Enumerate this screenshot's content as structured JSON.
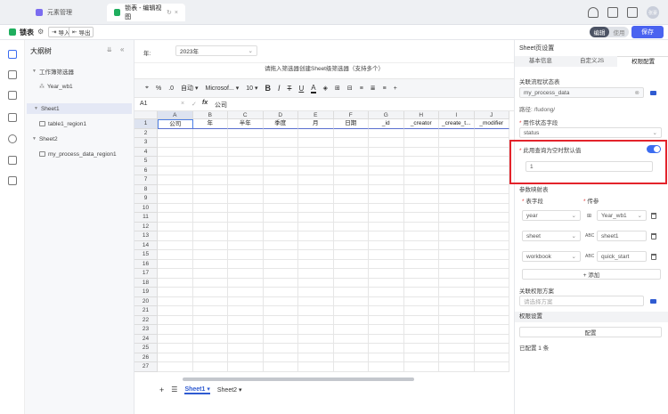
{
  "tabs": {
    "elements": "元素管理",
    "sheet_edit": "锁表 - 编辑视图"
  },
  "avatar_text": "张豪",
  "toolbar": {
    "title": "锁表",
    "import": "导入",
    "export": "导出",
    "mode_edit": "编辑",
    "mode_use": "使用",
    "save": "保存"
  },
  "outline": {
    "title": "大纲树",
    "filter_group": "工作簿筛选器",
    "filter_item": "Year_wb1",
    "sheet1": "Sheet1",
    "sheet1_region": "table1_region1",
    "sheet2": "Sheet2",
    "sheet2_region": "my_process_data_region1"
  },
  "filter": {
    "label": "年:",
    "value": "2023年",
    "hint": "请拖入筛选器创建Sheet级筛选器（支持多个）"
  },
  "format": {
    "font": "Microsof...",
    "size": "10",
    "auto": "自动"
  },
  "formula": {
    "cell_ref": "A1",
    "value": "公司"
  },
  "grid": {
    "columns": [
      "A",
      "B",
      "C",
      "D",
      "E",
      "F",
      "G",
      "H",
      "I",
      "J"
    ],
    "row1": [
      "公司",
      "年",
      "半年",
      "季度",
      "月",
      "日期",
      "_id",
      "_creator",
      "_create_t...",
      "_modifier"
    ],
    "rows": [
      "1",
      "2",
      "3",
      "4",
      "5",
      "6",
      "7",
      "8",
      "9",
      "10",
      "11",
      "12",
      "13",
      "14",
      "15",
      "16",
      "17",
      "18",
      "19",
      "20",
      "21",
      "22",
      "23",
      "24",
      "25",
      "26",
      "27"
    ]
  },
  "sheets": [
    "Sheet1",
    "Sheet2"
  ],
  "panel": {
    "title": "Sheet页设置",
    "tabs": [
      "基本信息",
      "自定义JS",
      "权限配置"
    ],
    "flow_table_label": "关联流程状态表",
    "flow_table_value": "my_process_data",
    "path": "路径: /fudong/",
    "status_label": "用作状态字段",
    "status_value": "status",
    "default_label": "此用查询为空时默认值",
    "default_value": "1",
    "param_map_label": "参数映射表",
    "col_table_field": "表字段",
    "col_param": "传参",
    "params": [
      {
        "field": "year",
        "param": "Year_wb1"
      },
      {
        "field": "sheet",
        "param": "sheet1"
      },
      {
        "field": "workbook",
        "param": "quick_start"
      }
    ],
    "add": "+ 添加",
    "perm_scheme_label": "关联权限方案",
    "perm_scheme_placeholder": "请选择方案",
    "perm_section": "权限设置",
    "config_btn": "配置",
    "configured": "已配置 1 条"
  },
  "colors": {
    "accent": "#4a63f0",
    "highlight": "#e3232b"
  }
}
